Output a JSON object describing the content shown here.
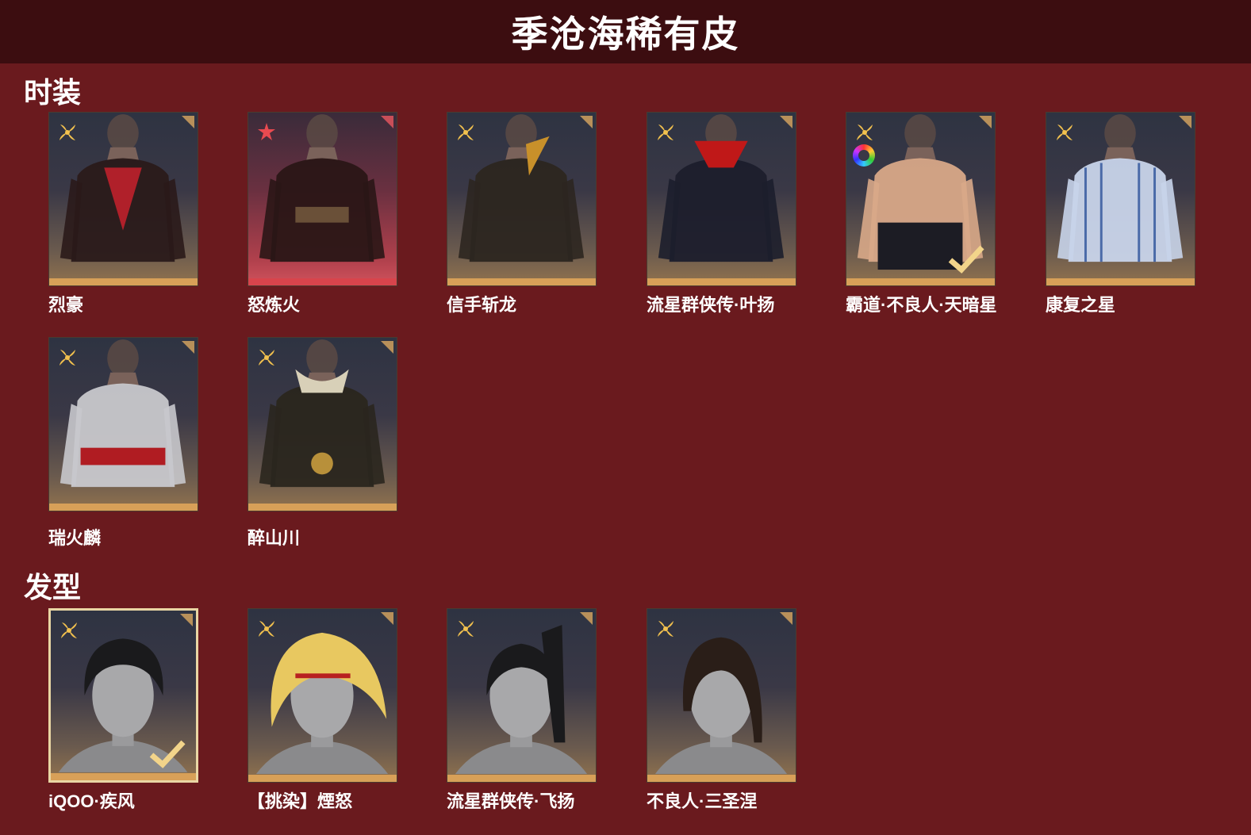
{
  "header": {
    "title": "季沧海稀有皮"
  },
  "sections": {
    "outfits": {
      "title": "时装",
      "items": [
        {
          "name": "烈豪"
        },
        {
          "name": "怒炼火"
        },
        {
          "name": "信手斩龙"
        },
        {
          "name": "流星群侠传·叶扬"
        },
        {
          "name": "霸道·不良人·天暗星"
        },
        {
          "name": "康复之星"
        },
        {
          "name": "瑞火麟"
        },
        {
          "name": "醉山川"
        }
      ]
    },
    "hairstyles": {
      "title": "发型",
      "items": [
        {
          "name": "iQOO·疾风"
        },
        {
          "name": "【挑染】煙怒"
        },
        {
          "name": "流星群侠传·飞扬"
        },
        {
          "name": "不良人·三圣涅"
        }
      ]
    }
  },
  "colors": {
    "background": "#6a1a1e",
    "header_bg": "#3c0d10",
    "gold": "#d8a058",
    "red_rarity": "#d8444c"
  },
  "icons": {
    "rarity": "gold-flower-icon",
    "rarity_red": "red-flower-icon",
    "owned": "checkmark-icon",
    "dye": "color-wheel-icon"
  }
}
